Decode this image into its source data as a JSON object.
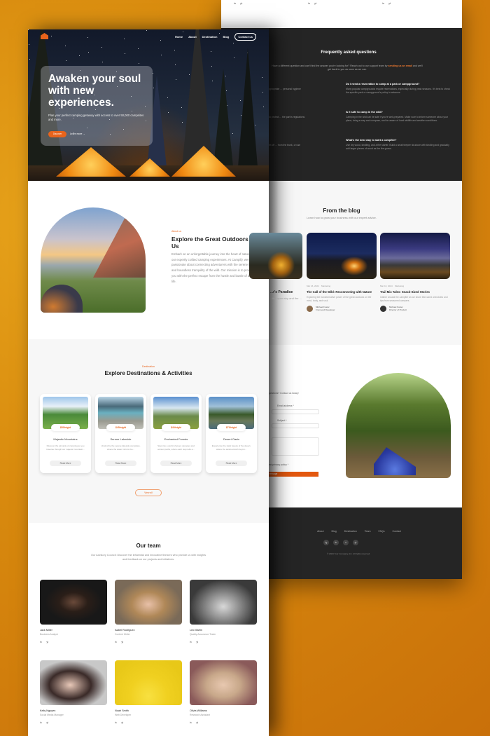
{
  "colors": {
    "accent": "#e8641c",
    "dark": "#252525",
    "background": "#d88a0e"
  },
  "back_page": {
    "top_social": [
      [
        "in",
        "yt"
      ],
      [
        "in",
        "yt"
      ],
      [
        "in",
        "yt"
      ]
    ],
    "faq": {
      "title": "Frequently asked questions",
      "intro_before": "Have a different question and can't find the answer you're looking for? Reach out to our support team by ",
      "intro_link": "sending us an email",
      "intro_after": " and we'll get back to you as soon as we can.",
      "items": [
        {
          "q": "...camping trip?",
          "a": "...sleeping bag, first aid kit, water, food, and appropriate ... personal hygiene and any necessary federal ... activities."
        },
        {
          "q": "Do I need a reservation to camp at a park or campground?",
          "a": "Many popular campgrounds require reservations, especially during peak seasons. It's best to check the specific park or campground's policy in advance."
        },
        {
          "q": "...national park?",
          "a": "...typically restricted to designated campsites to protect ... the park's regulations before setting up camp."
        },
        {
          "q": "Is it safe to camp in the wild?",
          "a": "Camping in the wild can be safe if you're well-prepared. Make sure to inform someone about your plans, bring a map and compass, and be aware of local wildlife and weather conditions."
        },
        {
          "q": "...animals while camping?",
          "a": "...and hang it from a tree branch at least 10 feet off ... from the trunk, or use bear-proof storage boxes if ..."
        },
        {
          "q": "What's the best way to start a campfire?",
          "a": "Use dry wood, kindling, and a fire starter. Build a small teepee structure with kindling and gradually add larger pieces of wood as the fire grows."
        }
      ]
    },
    "blog": {
      "title": "From the blog",
      "subtitle": "Learn how to grow your business with our expert advice.",
      "posts": [
        {
          "title": "...r's Paradise",
          "excerpt": "...the open sky and the ...",
          "date": "",
          "category": "",
          "author": "",
          "role": ""
        },
        {
          "title": "The Call of the Wild: Reconnecting with Nature",
          "excerpt": "Exploring the transformative power of the great outdoors on the mind, body, and soul.",
          "date": "Mar 16, 2024",
          "category": "Marketing",
          "author": "Michael Foster",
          "role": "Front-end Developer"
        },
        {
          "title": "Trail Mix Tales: Snack-Sized Stories",
          "excerpt": "Gather around the campfire as we share bite-sized anecdotes and tips from seasoned campers.",
          "date": "Mar 16, 2024",
          "category": "Marketing",
          "author": "Michael Foster",
          "role": "Director of Product"
        }
      ]
    },
    "contact": {
      "intro": "...questions? Contact us today!",
      "email_label": "Email address *",
      "subject_label": "Subject *",
      "privacy_label": "...and privacy policy *",
      "send_label": "...d message"
    },
    "footer": {
      "nav": [
        "About",
        "Blog",
        "Destination",
        "Team",
        "FAQs",
        "Contact"
      ],
      "social": [
        "ig",
        "in",
        "x",
        "yt"
      ],
      "copyright": "© 2024 Your Company, Inc. All rights reserved."
    }
  },
  "front_page": {
    "nav": {
      "items": [
        "Home",
        "About",
        "Destination",
        "Blog"
      ],
      "cta": "Contact us"
    },
    "hero": {
      "title": "Awaken your soul with new experiences.",
      "subtitle": "Plan your perfect camping getaway with access to over 50,000 campsites and more.",
      "primary": "Discover",
      "secondary": "Learn more →"
    },
    "about": {
      "eyebrow": "About us",
      "title": "Explore the Great Outdoors with Us",
      "body": "Embark on an unforgettable journey into the heart of nature with our expertly crafted camping experiences. At Campify, we're passionate about connecting adventurers with the serene beauty and boundless tranquility of the wild. Our mission is to provide you with the perfect escape from the hustle and bustle of daily life."
    },
    "destinations": {
      "eyebrow": "Destination",
      "title": "Explore Destinations & Activities",
      "cards": [
        {
          "price": "$50/night",
          "name": "Majestic Mountains",
          "desc": "Discover the pinnacle of camping as you traverse through our majestic mountain...",
          "button": "Read More"
        },
        {
          "price": "$45/night",
          "name": "Serene Lakeside",
          "desc": "Unwind by the serene lakeside campsites, where the water mirrors the...",
          "button": "Read More"
        },
        {
          "price": "$40/night",
          "name": "Enchanted Forests",
          "desc": "Step into a world of green canopies and ancient paths, where each step tells a...",
          "button": "Read More"
        },
        {
          "price": "$70/night",
          "name": "Desert Oasis",
          "desc": "Experience the stark beauty of the desert, where the sands stretch beyon...",
          "button": "Read More"
        }
      ],
      "view_all": "View all"
    },
    "team": {
      "title": "Our team",
      "subtitle": "Our Advisory Council: Discover the influential and innovative thinkers who provide us with insights and feedback on our projects and initiatives.",
      "members": [
        {
          "name": "Jack Miller",
          "role": "Business Analyst"
        },
        {
          "name": "Isabel Rodriguez",
          "role": "Content Writer"
        },
        {
          "name": "Leo Martin",
          "role": "Quality Assurance Tester"
        },
        {
          "name": "Kelly Nguyen",
          "role": "Social Media Manager"
        },
        {
          "name": "Noah Smith",
          "role": "Web Developer"
        },
        {
          "name": "Olivia Williams",
          "role": "Research Assistant"
        }
      ],
      "icons": [
        "in",
        "yt"
      ]
    }
  }
}
